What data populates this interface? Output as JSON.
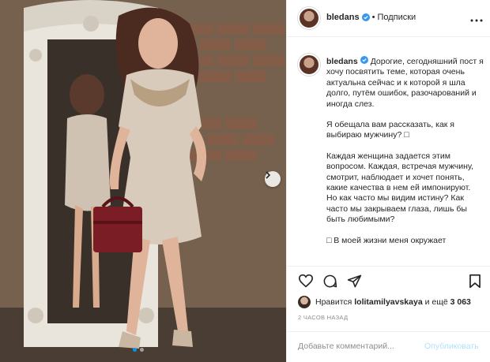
{
  "post": {
    "username": "bledans",
    "follow_label": "Подписки",
    "separator": "•",
    "photo_alt": "Woman in a shimmering beige dress holding a burgundy handbag next to an ornate white mirror",
    "carousel": {
      "active_index": 0,
      "count": 2
    },
    "caption_paragraphs": [
      "Дорогие, сегодняшний пост я хочу посвятить теме, которая очень актуальна сейчас и к которой я шла долго, путём ошибок, разочарований и иногда слез.",
      "Я обещала вам рассказать, как я выбираю мужчину? □",
      "Каждая женщина задается этим вопросом. Каждая, встречая мужчину, смотрит, наблюдает и хочет понять, какие качества в нем ей импонируют.",
      "Но как часто мы видим истину? Как часто мы закрываем глаза, лишь бы быть любимыми?",
      "□ В моей жизни меня окружает"
    ],
    "likes": {
      "prefix": "Нравится",
      "liker": "lolitamilyavskaya",
      "middle": "и ещё",
      "count": "3 063"
    },
    "timestamp": "2 ЧАСОВ НАЗАД",
    "comment": {
      "placeholder": "Добавьте комментарий...",
      "post_label": "Опубликовать"
    }
  },
  "colors": {
    "verified": "#3897f0",
    "link_disabled": "#b2dffc",
    "muted": "#8e8e8e",
    "border": "#efefef"
  },
  "icons": [
    "verified-badge-icon",
    "more-options-icon",
    "heart-icon",
    "comment-icon",
    "share-icon",
    "bookmark-icon",
    "chevron-right-icon"
  ]
}
